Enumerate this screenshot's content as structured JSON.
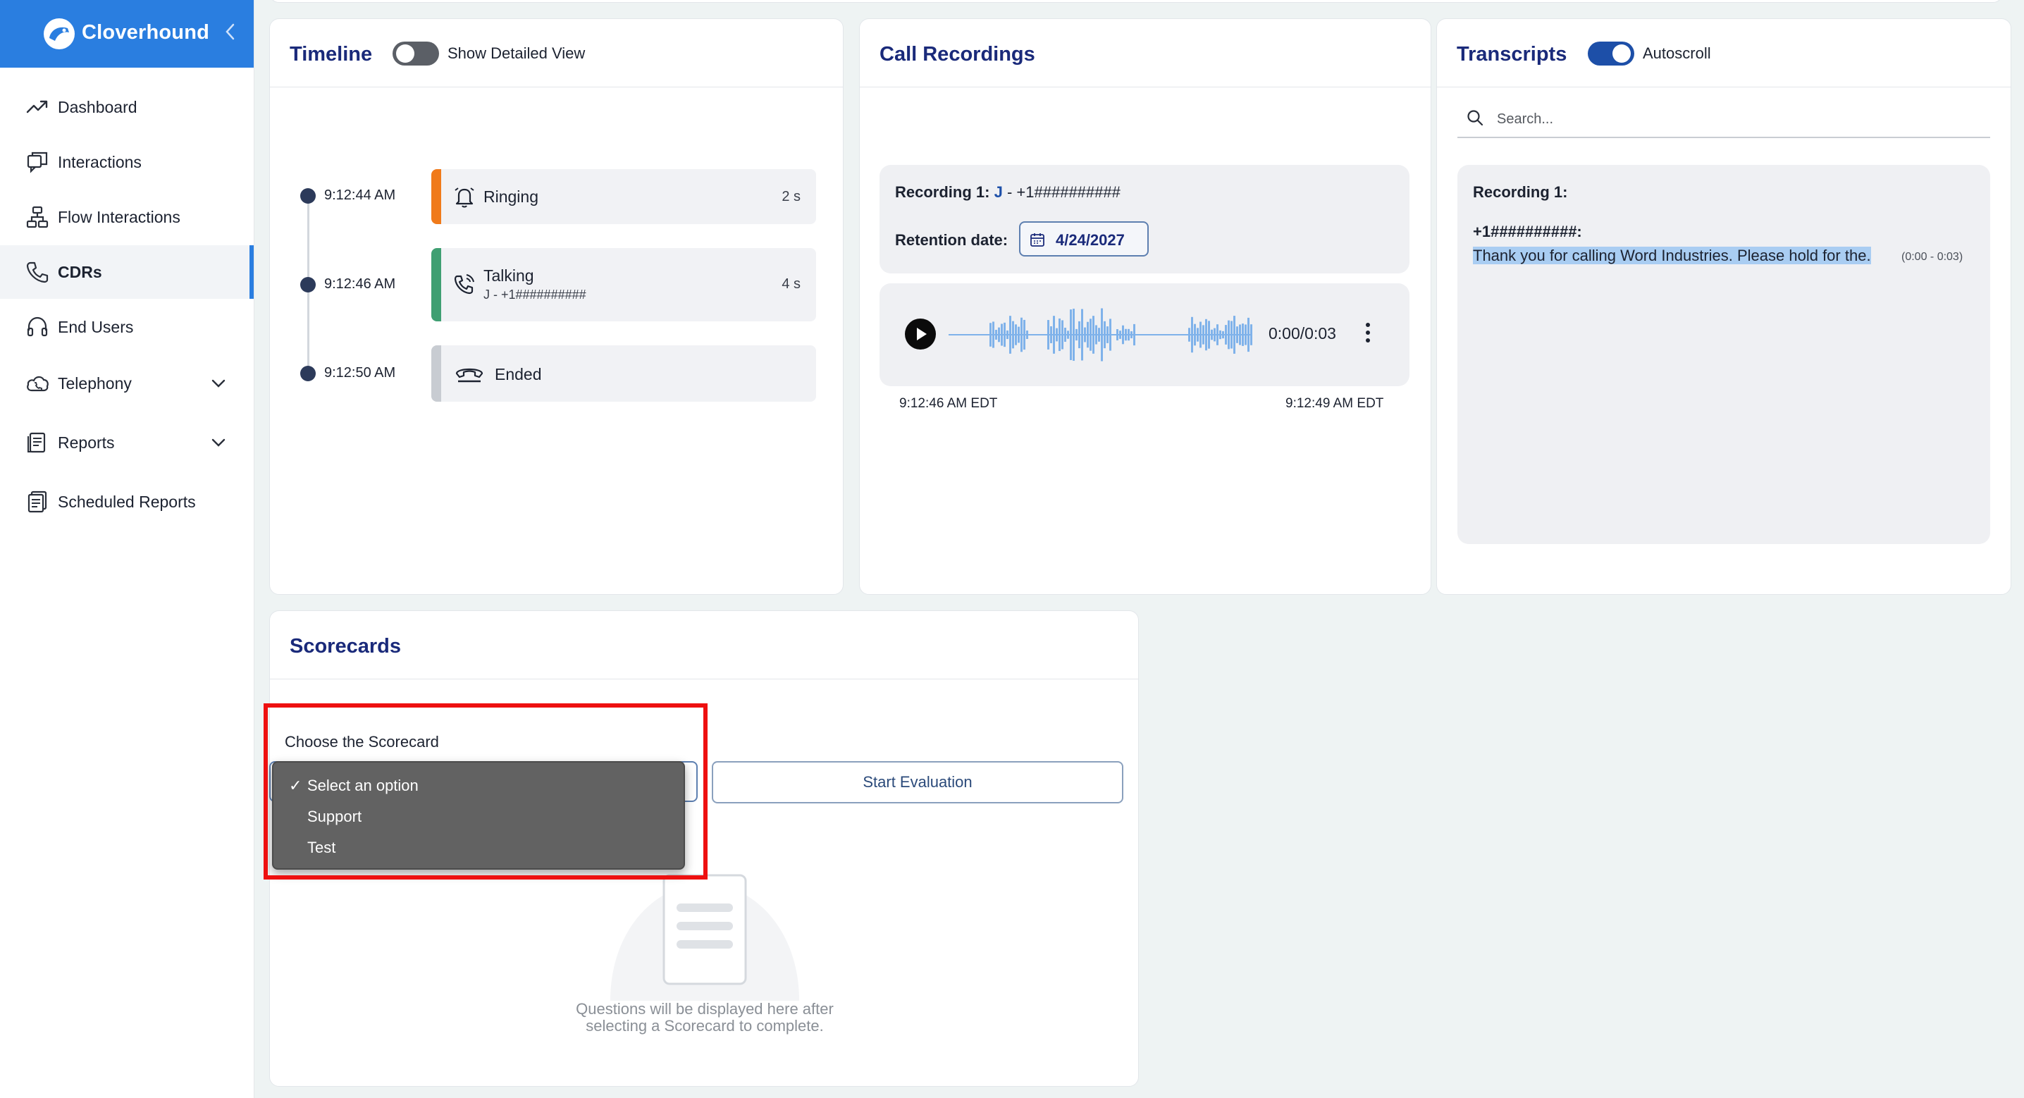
{
  "app": {
    "brand": "Cloverhound"
  },
  "sidebar": {
    "items": [
      {
        "label": "Dashboard",
        "icon": "trending-up-icon"
      },
      {
        "label": "Interactions",
        "icon": "chat-icon"
      },
      {
        "label": "Flow Interactions",
        "icon": "flow-icon"
      },
      {
        "label": "CDRs",
        "icon": "phone-icon",
        "active": true
      },
      {
        "label": "End Users",
        "icon": "headset-icon"
      },
      {
        "label": "Telephony",
        "icon": "cloud-phone-icon",
        "expandable": true
      },
      {
        "label": "Reports",
        "icon": "report-icon",
        "expandable": true
      },
      {
        "label": "Scheduled Reports",
        "icon": "scheduled-report-icon"
      }
    ]
  },
  "timeline": {
    "title": "Timeline",
    "toggle_label": "Show Detailed View",
    "toggle_on": false,
    "events": [
      {
        "time": "9:12:44 AM",
        "label": "Ringing",
        "sub": "",
        "duration": "2 s",
        "color": "#f07a1a",
        "icon": "bell-icon"
      },
      {
        "time": "9:12:46 AM",
        "label": "Talking",
        "sub": "J - +1##########",
        "duration": "4 s",
        "color": "#3f9f72",
        "icon": "phone-call-icon"
      },
      {
        "time": "9:12:50 AM",
        "label": "Ended",
        "sub": "",
        "duration": "",
        "color": "#c8ccd2",
        "icon": "hangup-icon"
      }
    ]
  },
  "recordings": {
    "title": "Call Recordings",
    "rec_label": "Recording 1:",
    "rec_agent": "J",
    "rec_sep": "-",
    "rec_number": "+1##########",
    "retention_label": "Retention date:",
    "retention_date": "4/24/2027",
    "player_time": "0:00/0:03",
    "start_time": "9:12:46 AM EDT",
    "end_time": "9:12:49 AM EDT"
  },
  "transcripts": {
    "title": "Transcripts",
    "toggle_label": "Autoscroll",
    "toggle_on": true,
    "search_placeholder": "Search...",
    "recording_label": "Recording 1:",
    "speaker": "+1##########:",
    "text": "Thank you for calling Word Industries. Please hold for the.",
    "range": "(0:00 - 0:03)"
  },
  "scorecards": {
    "title": "Scorecards",
    "choose_label": "Choose the Scorecard",
    "options": [
      "Select an option",
      "Support",
      "Test"
    ],
    "selected_index": 0,
    "start_button": "Start Evaluation",
    "empty_text_line1": "Questions will be displayed here after",
    "empty_text_line2": "selecting a Scorecard to complete."
  },
  "colors": {
    "brand": "#2a7ee0",
    "title": "#1a2a7a",
    "highlight": "#ee1010"
  }
}
